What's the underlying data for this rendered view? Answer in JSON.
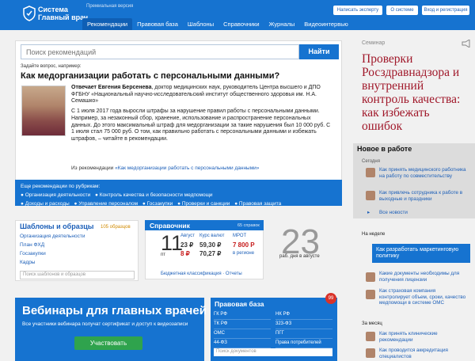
{
  "header": {
    "logo_line1": "Система",
    "logo_line2": "Главный врач",
    "premium": "Премиальная версия",
    "nav": [
      "Рекомендации",
      "Правовая база",
      "Шаблоны",
      "Справочники",
      "Журналы",
      "Видеоинтервью"
    ],
    "buttons": [
      "Написать эксперту",
      "О системе",
      "Вход и регистрация"
    ]
  },
  "search": {
    "placeholder": "Поиск рекомендаций",
    "button": "Найти",
    "ask": "Задайте вопрос, например:",
    "question": "Как медорганизации работать с персональными данными?",
    "author": "Отвечает Евгения Берсенева",
    "author_desc": ", доктор медицинских наук, руководитель Центра высшего и ДПО ФГБНУ «Национальный научно-исследовательский институт общественного здоровья им. Н.А. Семашко»",
    "answer": "С 1 июля 2017 года выросли штрафы за нарушение правил работы с персональными данными. Например, за незаконный сбор, хранение, использование и распространение персональных данных. До этого максимальный штраф для медорганизации за такие нарушения был 10 000 руб. С 1 июля стал 75 000 руб. О том, как правильно работать с персональными данными и избежать штрафов, – читайте в рекомендации.",
    "from_label": "Из рекомендации",
    "from_link": "«Как медорганизации работать с персональными данными»"
  },
  "rubrics": {
    "label": "Еще рекомендации по рубрикам:",
    "items": [
      "Организация деятельности",
      "Контроль качества и безопасности медпомощи",
      "Доходы и расходы",
      "Управление персоналом",
      "Госзакупки",
      "Проверки и санкции",
      "Правовая защита"
    ]
  },
  "seminar": {
    "label": "Семинар",
    "title": "Проверки Росздравнадзора и внутренний контроль качества: как избежать ошибок"
  },
  "news": {
    "title": "Новое в работе",
    "today": "Сегодня",
    "items": [
      "Как принять медицинского работника на работу по совместительству",
      "Как привлечь сотрудника к работе в выходные и праздники"
    ],
    "all": "Все новости"
  },
  "week": {
    "label": "На неделе",
    "highlight": "Как разработать маркетинговую политику",
    "items": [
      "Какие документы необходимы для получения лицензии",
      "Как страховая компания контролирует объем, сроки, качество медпомощи в системе ОМС"
    ]
  },
  "month": {
    "label": "За месяц",
    "items": [
      "Как принять клинические рекомендации",
      "Как проводится аккредитация специалистов"
    ]
  },
  "templates": {
    "title": "Шаблоны и образцы",
    "count": "105 образцов",
    "items": [
      "Организация деятельности",
      "План ФХД",
      "Госзакупки",
      "Кадры"
    ],
    "search": "Поиск шаблонов и образцов"
  },
  "reference": {
    "title": "Справочник",
    "count": "65 справок",
    "day": "11",
    "weekday": "пт",
    "col1_head": "Август",
    "col1_vals": [
      "23 ₽",
      "8 ₽"
    ],
    "col2_head": "Курс валют",
    "col2_vals": [
      "59,30 ₽",
      "70,27 ₽"
    ],
    "col3_head": "МРОТ",
    "col3_val": "7 800 Р",
    "col3_note": "в регионе",
    "links": "Бюджетная классификация · Отчеты"
  },
  "workdays": {
    "value": "23",
    "label": "раб. дня в августе"
  },
  "webinar": {
    "title": "Вебинары для главных врачей",
    "text": "Все участники вебинара получат сертификат и доступ к видеозаписи",
    "button": "Участвовать"
  },
  "legal": {
    "title": "Правовая база",
    "badge": "99",
    "items": [
      "ГК РФ",
      "НК РФ",
      "ТК РФ",
      "323-ФЗ",
      "ОМС",
      "ПГГ",
      "44-ФЗ",
      "Права потребителей"
    ],
    "search": "Поиск документов"
  },
  "colors": {
    "primary": "#1673d0",
    "seminar": "#a0182a",
    "button_green": "#2fa34d",
    "badge": "#d9332a"
  }
}
